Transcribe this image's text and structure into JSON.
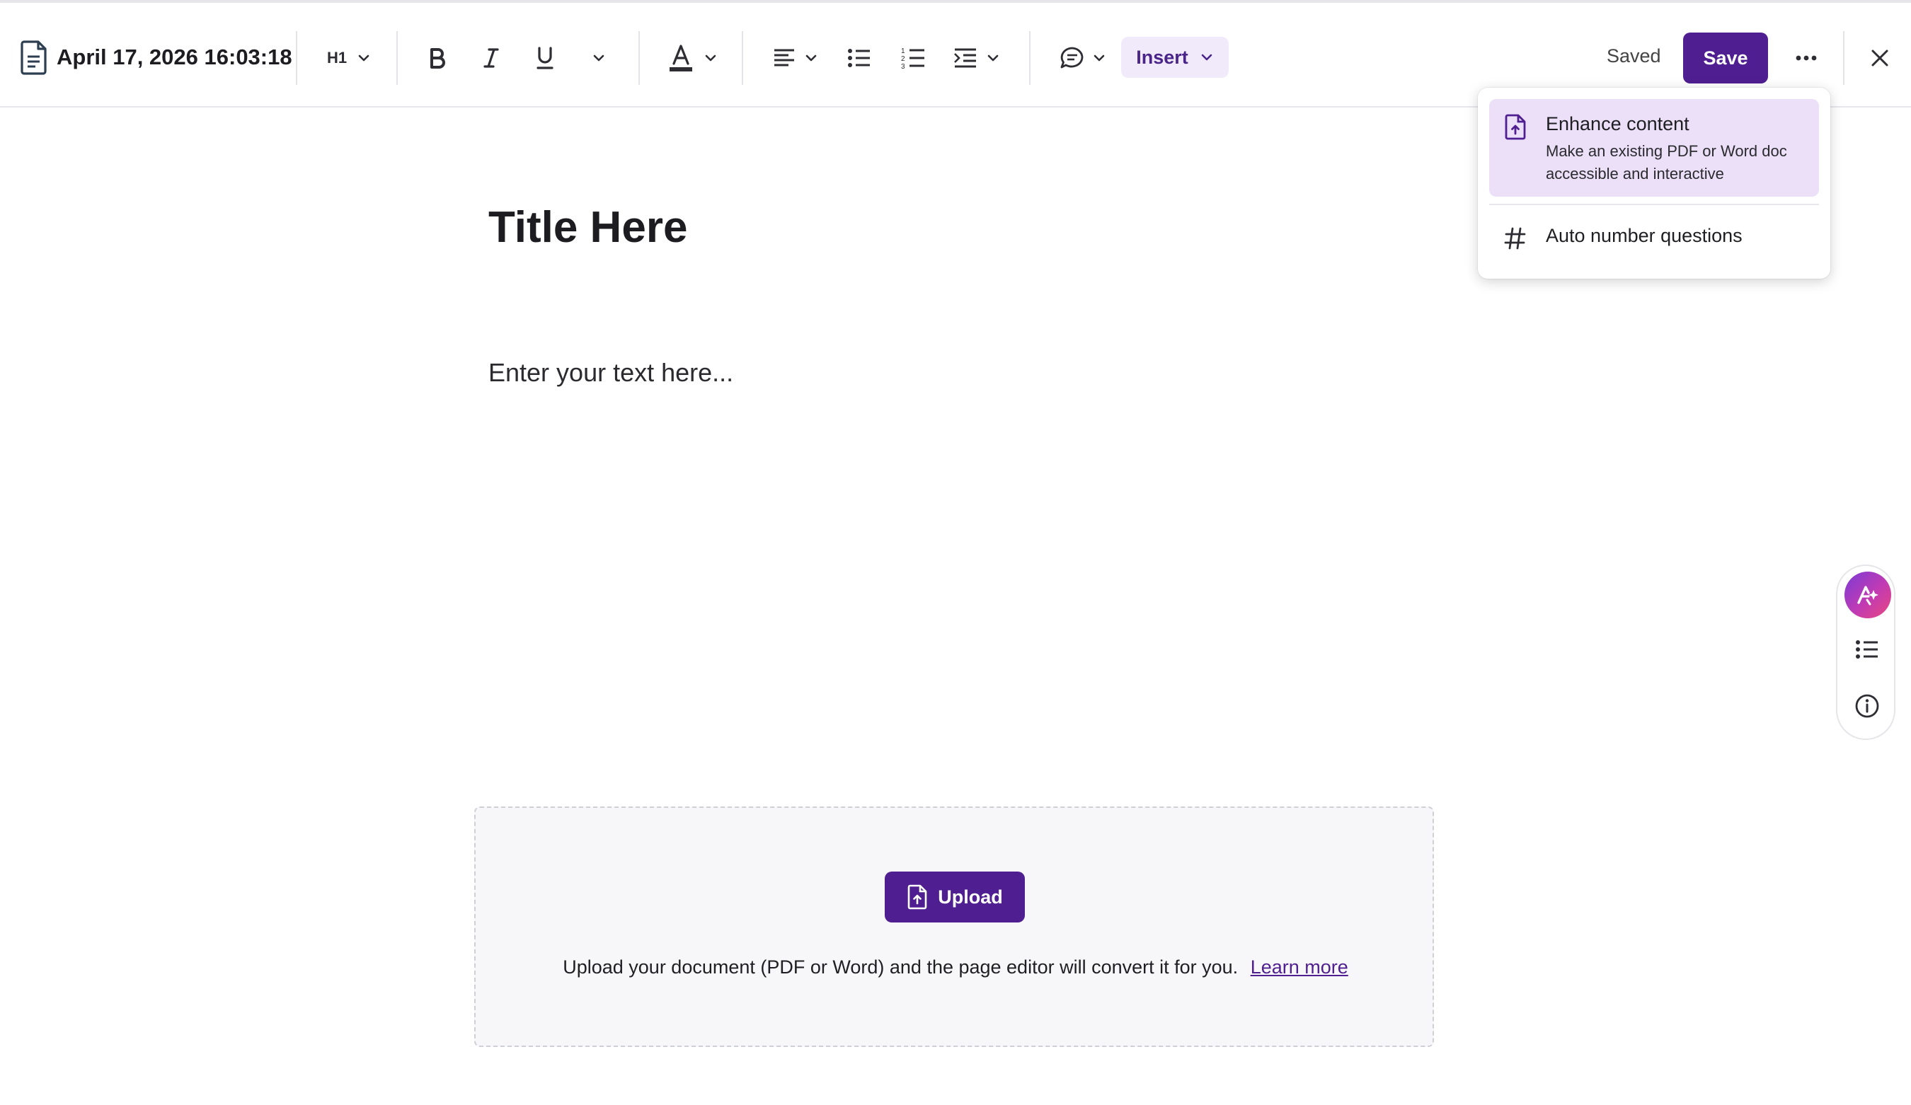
{
  "header": {
    "doc_title": "April 17, 2026 16:03:18",
    "heading_level": "H1",
    "insert_label": "Insert",
    "status": "Saved",
    "save_label": "Save"
  },
  "editor": {
    "title": "Title Here",
    "body_placeholder": "Enter your text here..."
  },
  "upload": {
    "button_label": "Upload",
    "description": "Upload your document (PDF or Word) and the page editor will convert it for you.",
    "learn_more": "Learn more"
  },
  "insert_menu": {
    "items": [
      {
        "title": "Enhance content",
        "description": "Make an existing PDF or Word doc accessible and interactive",
        "icon": "file-upload-icon"
      },
      {
        "title": "Auto number questions",
        "icon": "hash-icon"
      }
    ]
  },
  "icons": {
    "toolbar": [
      "bold-icon",
      "italic-icon",
      "underline-icon",
      "text-color-icon",
      "align-left-icon",
      "bullet-list-icon",
      "numbered-list-icon",
      "indent-icon",
      "comment-icon",
      "more-icon",
      "close-icon"
    ],
    "side_rail": [
      "ai-assistant-icon",
      "outline-icon",
      "info-icon"
    ]
  },
  "colors": {
    "accent": "#4f1f91",
    "insert_bg": "#f1eafb",
    "menu_highlight": "#ebe0f8"
  }
}
